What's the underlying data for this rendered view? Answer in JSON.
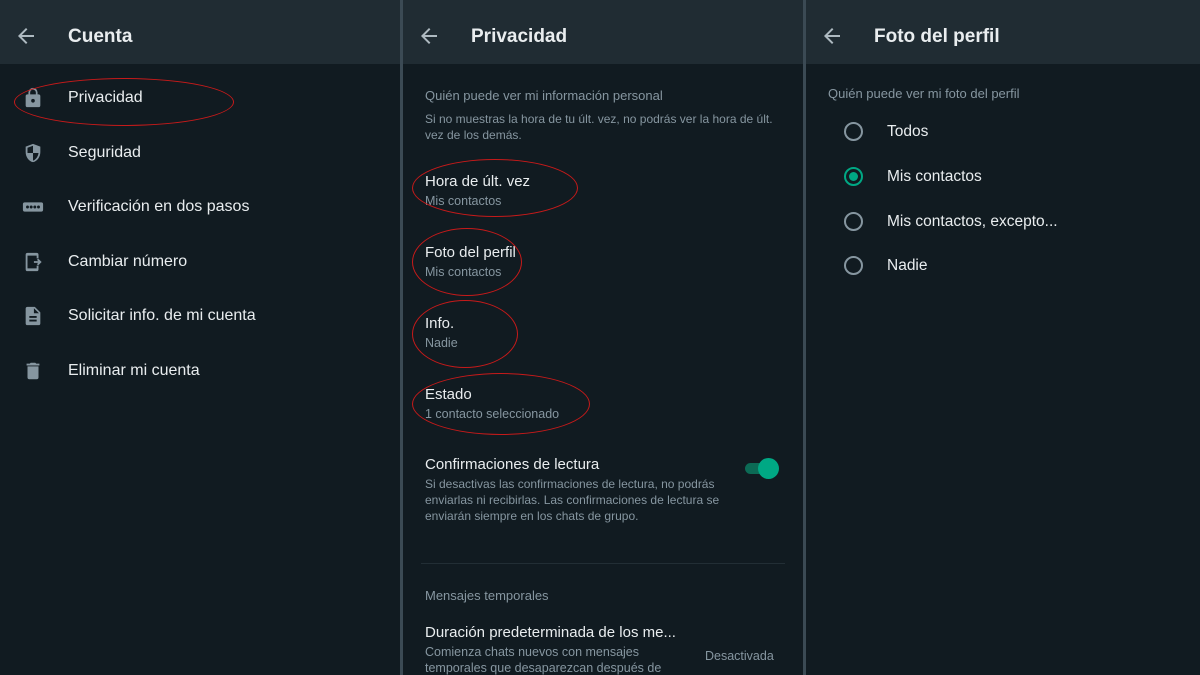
{
  "colors": {
    "background": "#111b21",
    "header": "#202c33",
    "accent": "#00a884",
    "annotation": "#c61a1a",
    "secondary_text": "#8696a0"
  },
  "panel1": {
    "title": "Cuenta",
    "items": [
      {
        "label": "Privacidad",
        "icon": "lock-icon"
      },
      {
        "label": "Seguridad",
        "icon": "shield-icon"
      },
      {
        "label": "Verificación en dos pasos",
        "icon": "dots-password-icon"
      },
      {
        "label": "Cambiar número",
        "icon": "phone-change-icon"
      },
      {
        "label": "Solicitar info. de mi cuenta",
        "icon": "document-icon"
      },
      {
        "label": "Eliminar mi cuenta",
        "icon": "trash-icon"
      }
    ]
  },
  "panel2": {
    "title": "Privacidad",
    "section_header": "Quién puede ver mi información personal",
    "section_desc": "Si no muestras la hora de tu últ. vez, no podrás ver la hora de últ. vez de los demás.",
    "settings": [
      {
        "title": "Hora de últ. vez",
        "value": "Mis contactos"
      },
      {
        "title": "Foto del perfil",
        "value": "Mis contactos"
      },
      {
        "title": "Info.",
        "value": "Nadie"
      },
      {
        "title": "Estado",
        "value": "1 contacto seleccionado"
      }
    ],
    "read_receipts": {
      "title": "Confirmaciones de lectura",
      "desc": "Si desactivas las confirmaciones de lectura, no podrás enviarlas ni recibirlas. Las confirmaciones de lectura se enviarán siempre en los chats de grupo.",
      "enabled": true
    },
    "temp_header": "Mensajes temporales",
    "temp_setting": {
      "title": "Duración predeterminada de los me...",
      "desc": "Comienza chats nuevos con mensajes temporales que desaparezcan después de",
      "value": "Desactivada"
    }
  },
  "panel3": {
    "title": "Foto del perfil",
    "header": "Quién puede ver mi foto del perfil",
    "options": [
      {
        "label": "Todos",
        "selected": false
      },
      {
        "label": "Mis contactos",
        "selected": true
      },
      {
        "label": "Mis contactos, excepto...",
        "selected": false
      },
      {
        "label": "Nadie",
        "selected": false
      }
    ]
  }
}
